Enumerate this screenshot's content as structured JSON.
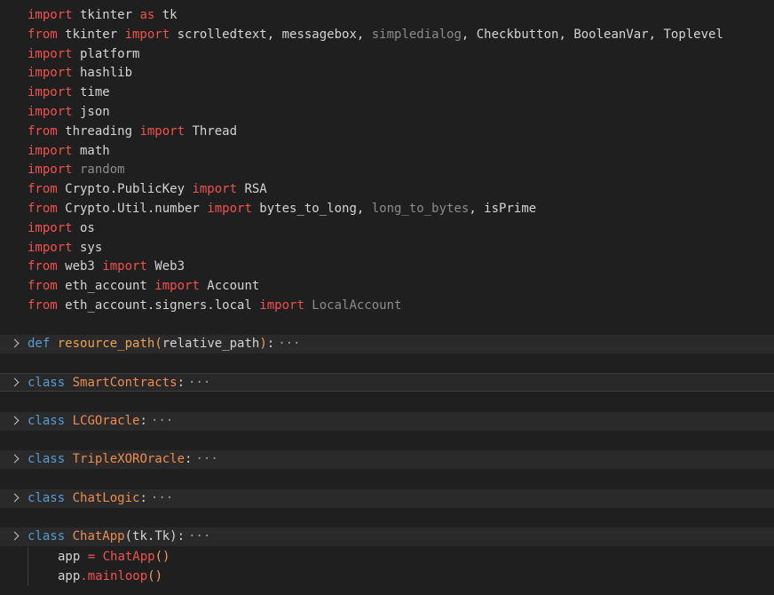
{
  "imports": [
    {
      "parts": [
        {
          "t": "import",
          "c": "kw-red"
        },
        {
          "t": " tkinter ",
          "c": "plain"
        },
        {
          "t": "as",
          "c": "kw-red"
        },
        {
          "t": " tk",
          "c": "plain"
        }
      ]
    },
    {
      "parts": [
        {
          "t": "from",
          "c": "kw-red"
        },
        {
          "t": " tkinter ",
          "c": "plain"
        },
        {
          "t": "import",
          "c": "kw-red"
        },
        {
          "t": " scrolledtext, messagebox, ",
          "c": "plain"
        },
        {
          "t": "simpledialog",
          "c": "dim"
        },
        {
          "t": ", Checkbutton, BooleanVar, Toplevel",
          "c": "plain"
        }
      ]
    },
    {
      "parts": [
        {
          "t": "import",
          "c": "kw-red"
        },
        {
          "t": " platform",
          "c": "plain"
        }
      ]
    },
    {
      "parts": [
        {
          "t": "import",
          "c": "kw-red"
        },
        {
          "t": " hashlib",
          "c": "plain"
        }
      ]
    },
    {
      "parts": [
        {
          "t": "import",
          "c": "kw-red"
        },
        {
          "t": " time",
          "c": "plain"
        }
      ]
    },
    {
      "parts": [
        {
          "t": "import",
          "c": "kw-red"
        },
        {
          "t": " json",
          "c": "plain"
        }
      ]
    },
    {
      "parts": [
        {
          "t": "from",
          "c": "kw-red"
        },
        {
          "t": " threading ",
          "c": "plain"
        },
        {
          "t": "import",
          "c": "kw-red"
        },
        {
          "t": " Thread",
          "c": "plain"
        }
      ]
    },
    {
      "parts": [
        {
          "t": "import",
          "c": "kw-red"
        },
        {
          "t": " math",
          "c": "plain"
        }
      ]
    },
    {
      "parts": [
        {
          "t": "import",
          "c": "kw-red"
        },
        {
          "t": " random",
          "c": "dim"
        }
      ]
    },
    {
      "parts": [
        {
          "t": "from",
          "c": "kw-red"
        },
        {
          "t": " Crypto.PublicKey ",
          "c": "plain"
        },
        {
          "t": "import",
          "c": "kw-red"
        },
        {
          "t": " RSA",
          "c": "plain"
        }
      ]
    },
    {
      "parts": [
        {
          "t": "from",
          "c": "kw-red"
        },
        {
          "t": " Crypto.Util.number ",
          "c": "plain"
        },
        {
          "t": "import",
          "c": "kw-red"
        },
        {
          "t": " bytes_to_long, ",
          "c": "plain"
        },
        {
          "t": "long_to_bytes",
          "c": "dim"
        },
        {
          "t": ", isPrime",
          "c": "plain"
        }
      ]
    },
    {
      "parts": [
        {
          "t": "import",
          "c": "kw-red"
        },
        {
          "t": " os",
          "c": "plain"
        }
      ]
    },
    {
      "parts": [
        {
          "t": "import",
          "c": "kw-red"
        },
        {
          "t": " sys",
          "c": "plain"
        }
      ]
    },
    {
      "parts": [
        {
          "t": "from",
          "c": "kw-red"
        },
        {
          "t": " web3 ",
          "c": "plain"
        },
        {
          "t": "import",
          "c": "kw-red"
        },
        {
          "t": " Web3",
          "c": "plain"
        }
      ]
    },
    {
      "parts": [
        {
          "t": "from",
          "c": "kw-red"
        },
        {
          "t": " eth_account ",
          "c": "plain"
        },
        {
          "t": "import",
          "c": "kw-red"
        },
        {
          "t": " Account",
          "c": "plain"
        }
      ]
    },
    {
      "parts": [
        {
          "t": "from",
          "c": "kw-red"
        },
        {
          "t": " eth_account.signers.local ",
          "c": "plain"
        },
        {
          "t": "import",
          "c": "kw-red"
        },
        {
          "t": " LocalAccount",
          "c": "dim"
        }
      ]
    }
  ],
  "folded": [
    {
      "keyword": "def",
      "name": "resource_path",
      "args": "(relative_path)",
      "colon": ":",
      "ellipsis": "···"
    },
    {
      "keyword": "class",
      "name": "SmartContracts",
      "args": "",
      "colon": ":",
      "ellipsis": "···"
    },
    {
      "keyword": "class",
      "name": "LCGOracle",
      "args": "",
      "colon": ":",
      "ellipsis": "···"
    },
    {
      "keyword": "class",
      "name": "TripleXOROracle",
      "args": "",
      "colon": ":",
      "ellipsis": "···"
    },
    {
      "keyword": "class",
      "name": "ChatLogic",
      "args": "",
      "colon": ":",
      "ellipsis": "···"
    },
    {
      "keyword": "class",
      "name": "ChatApp",
      "args": "(tk.Tk)",
      "colon": ":",
      "ellipsis": "···"
    }
  ],
  "main_lines": [
    {
      "parts": [
        {
          "t": "app ",
          "c": "plain"
        },
        {
          "t": "=",
          "c": "kw-red"
        },
        {
          "t": " ",
          "c": "plain"
        },
        {
          "t": "ChatApp",
          "c": "kw-red"
        },
        {
          "t": "()",
          "c": "fn"
        }
      ]
    },
    {
      "parts": [
        {
          "t": "app",
          "c": "plain"
        },
        {
          "t": ".",
          "c": "kw-red"
        },
        {
          "t": "mainloop",
          "c": "kw-red"
        },
        {
          "t": "()",
          "c": "fn"
        }
      ]
    }
  ]
}
